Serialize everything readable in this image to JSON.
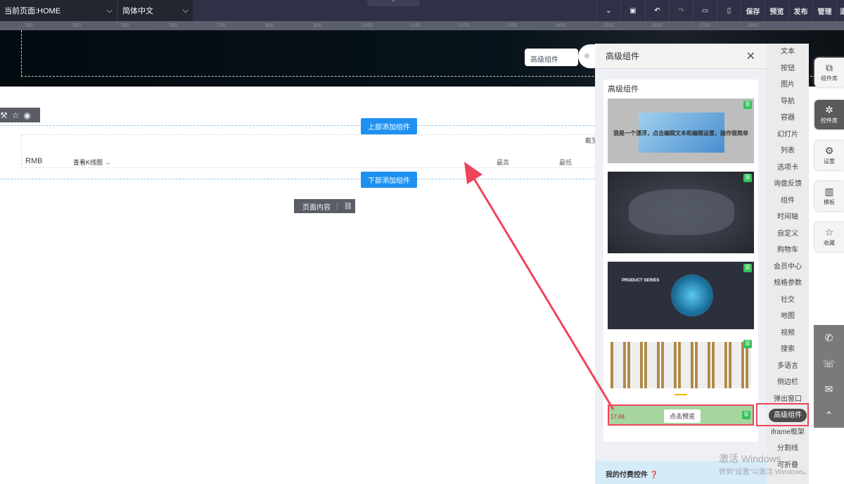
{
  "topbar": {
    "page_select": "当前页面:HOME",
    "lang_select": "简体中文",
    "actions": [
      "保存",
      "预览",
      "发布",
      "管理",
      "退"
    ]
  },
  "ruler": [
    "300",
    "400",
    "500",
    "600",
    "700",
    "800",
    "900",
    "1000",
    "1100",
    "1200",
    "1300",
    "1400",
    "1500",
    "1600",
    "1700",
    "1800"
  ],
  "canvas": {
    "tooltip": "高级组件",
    "add_top": "上部添加组件",
    "add_bottom": "下部添加组件",
    "currency": "RMB",
    "kline_link": "查看K线图 →",
    "col_high": "最高",
    "col_low": "最低",
    "cutoff": "截至",
    "page_content": "页面内容"
  },
  "panel": {
    "title": "高级组件",
    "section": "高级组件",
    "thumb1_text": "我是一个漂浮，点击编辑文本和编辑设置，操作很简单",
    "thumb3_title": "PRODUCT SERIES",
    "thumb5_value": "17.68",
    "preview_btn": "点击预览",
    "badge": "营",
    "footer": "我的付费控件"
  },
  "categories": [
    "文本",
    "按钮",
    "图片",
    "导航",
    "容器",
    "幻灯片",
    "列表",
    "选项卡",
    "询盘反馈",
    "组件",
    "时间轴",
    "自定义",
    "购物车",
    "会员中心",
    "规格参数",
    "社交",
    "地图",
    "视频",
    "搜索",
    "多语言",
    "侧边栏",
    "弹出窗口",
    "高级组件",
    "iframe框架",
    "分割线",
    "可折叠"
  ],
  "side_buttons": [
    "组件库",
    "控件库",
    "设置",
    "模板",
    "收藏"
  ],
  "watermark": {
    "line1": "激活 Windows",
    "line2": "转到\"设置\"以激活 Windows。"
  },
  "colors": {
    "accent": "#1e90ef",
    "highlight": "#f0445a"
  }
}
